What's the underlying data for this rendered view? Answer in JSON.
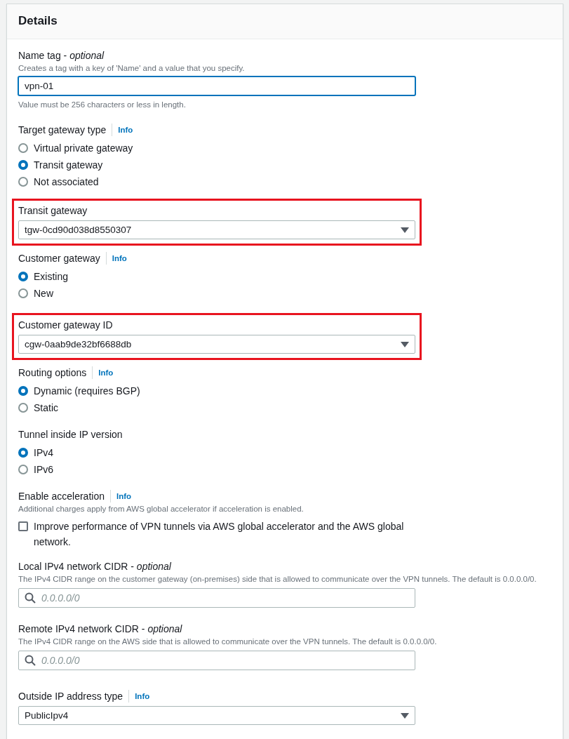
{
  "panel": {
    "title": "Details"
  },
  "fields": [
    {
      "kind": "text",
      "label": "Name tag - *optional*",
      "description": "Creates a tag with a key of 'Name' and a value that you specify.",
      "value": "vpn-01",
      "focused": true,
      "constraint": "Value must be 256 characters or less in length."
    },
    {
      "kind": "radio",
      "label": "Target gateway type",
      "info": "Info",
      "options": [
        {
          "label": "Virtual private gateway",
          "selected": false
        },
        {
          "label": "Transit gateway",
          "selected": true
        },
        {
          "label": "Not associated",
          "selected": false
        }
      ]
    },
    {
      "kind": "select",
      "label": "Transit gateway",
      "value": "tgw-0cd90d038d8550307",
      "highlighted": true
    },
    {
      "kind": "radio",
      "label": "Customer gateway",
      "info": "Info",
      "options": [
        {
          "label": "Existing",
          "selected": true
        },
        {
          "label": "New",
          "selected": false
        }
      ]
    },
    {
      "kind": "select",
      "label": "Customer gateway ID",
      "value": "cgw-0aab9de32bf6688db",
      "highlighted": true
    },
    {
      "kind": "radio",
      "label": "Routing options",
      "info": "Info",
      "options": [
        {
          "label": "Dynamic (requires BGP)",
          "selected": true
        },
        {
          "label": "Static",
          "selected": false
        }
      ]
    },
    {
      "kind": "radio",
      "label": "Tunnel inside IP version",
      "options": [
        {
          "label": "IPv4",
          "selected": true
        },
        {
          "label": "IPv6",
          "selected": false
        }
      ]
    },
    {
      "kind": "checkbox",
      "label": "Enable acceleration",
      "info": "Info",
      "description": "Additional charges apply from AWS global accelerator if acceleration is enabled.",
      "option": {
        "label": "Improve performance of VPN tunnels via AWS global accelerator and the AWS global network.",
        "checked": false
      }
    },
    {
      "kind": "search",
      "label": "Local IPv4 network CIDR - *optional*",
      "description": "The IPv4 CIDR range on the customer gateway (on-premises) side that is allowed to communicate over the VPN tunnels. The default is 0.0.0.0/0.",
      "placeholder": "0.0.0.0/0"
    },
    {
      "kind": "search",
      "label": "Remote IPv4 network CIDR - *optional*",
      "description": "The IPv4 CIDR range on the AWS side that is allowed to communicate over the VPN tunnels. The default is 0.0.0.0/0.",
      "placeholder": "0.0.0.0/0"
    },
    {
      "kind": "select",
      "label": "Outside IP address type",
      "info": "Info",
      "value": "PublicIpv4",
      "highlighted": false
    }
  ]
}
